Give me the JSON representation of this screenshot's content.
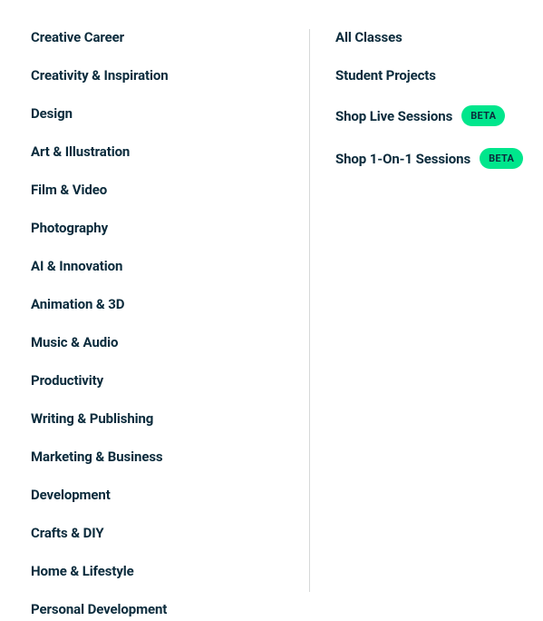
{
  "left_menu": {
    "items": [
      {
        "label": "Creative Career"
      },
      {
        "label": "Creativity & Inspiration"
      },
      {
        "label": "Design"
      },
      {
        "label": "Art & Illustration"
      },
      {
        "label": "Film & Video"
      },
      {
        "label": "Photography"
      },
      {
        "label": "AI & Innovation"
      },
      {
        "label": "Animation & 3D"
      },
      {
        "label": "Music & Audio"
      },
      {
        "label": "Productivity"
      },
      {
        "label": "Writing & Publishing"
      },
      {
        "label": "Marketing & Business"
      },
      {
        "label": "Development"
      },
      {
        "label": "Crafts & DIY"
      },
      {
        "label": "Home & Lifestyle"
      },
      {
        "label": "Personal Development"
      }
    ]
  },
  "right_menu": {
    "items": [
      {
        "label": "All Classes",
        "badge": null
      },
      {
        "label": "Student Projects",
        "badge": null
      },
      {
        "label": "Shop Live Sessions",
        "badge": "BETA"
      },
      {
        "label": "Shop 1-On-1 Sessions",
        "badge": "BETA"
      }
    ]
  }
}
